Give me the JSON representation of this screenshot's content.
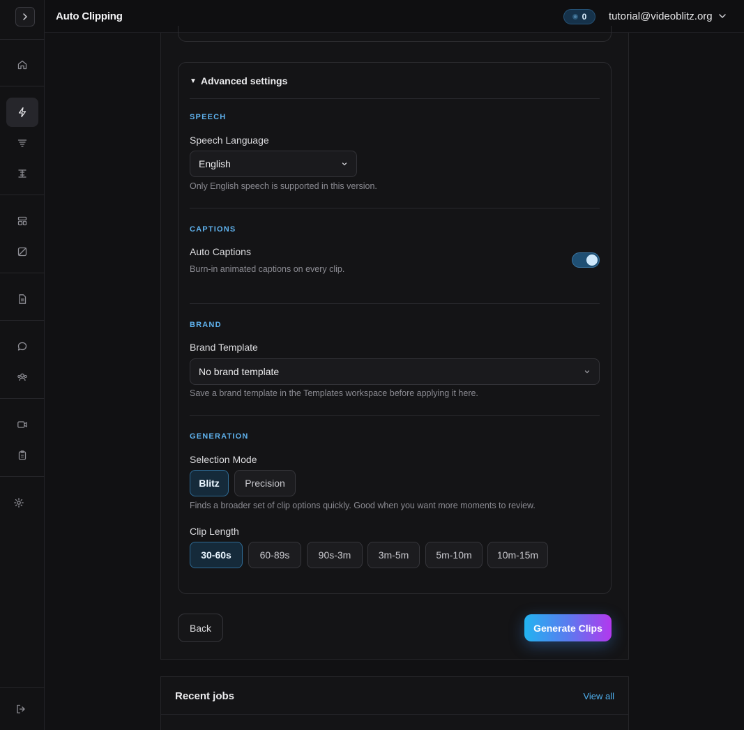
{
  "topbar": {
    "title": "Auto Clipping",
    "credits": "0",
    "user_email": "tutorial@videoblitz.org"
  },
  "sidebar": {
    "icons": [
      "chevron-right-icon",
      "home-icon",
      "lightning-icon",
      "filter-icon",
      "layout-icon",
      "template-icon",
      "crop-icon",
      "document-icon",
      "chat-icon",
      "users-icon",
      "video-icon",
      "clipboard-icon",
      "gear-icon",
      "logout-icon"
    ]
  },
  "advanced": {
    "header": "Advanced settings",
    "speech": {
      "section": "SPEECH",
      "label": "Speech Language",
      "value": "English",
      "hint": "Only English speech is supported in this version."
    },
    "captions": {
      "section": "CAPTIONS",
      "label": "Auto Captions",
      "hint": "Burn-in animated captions on every clip.",
      "enabled": true
    },
    "brand": {
      "section": "BRAND",
      "label": "Brand Template",
      "value": "No brand template",
      "hint": "Save a brand template in the Templates workspace before applying it here."
    },
    "generation": {
      "section": "GENERATION",
      "mode_label": "Selection Mode",
      "modes": [
        "Blitz",
        "Precision"
      ],
      "mode_selected": "Blitz",
      "mode_hint": "Finds a broader set of clip options quickly. Good when you want more moments to review.",
      "length_label": "Clip Length",
      "lengths": [
        "30-60s",
        "60-89s",
        "90s-3m",
        "3m-5m",
        "5m-10m",
        "10m-15m"
      ],
      "length_selected": "30-60s"
    }
  },
  "actions": {
    "back": "Back",
    "generate": "Generate Clips"
  },
  "recent": {
    "title": "Recent jobs",
    "view_all": "View all"
  },
  "colors": {
    "accent": "#5fb2ee",
    "background": "#111113"
  }
}
